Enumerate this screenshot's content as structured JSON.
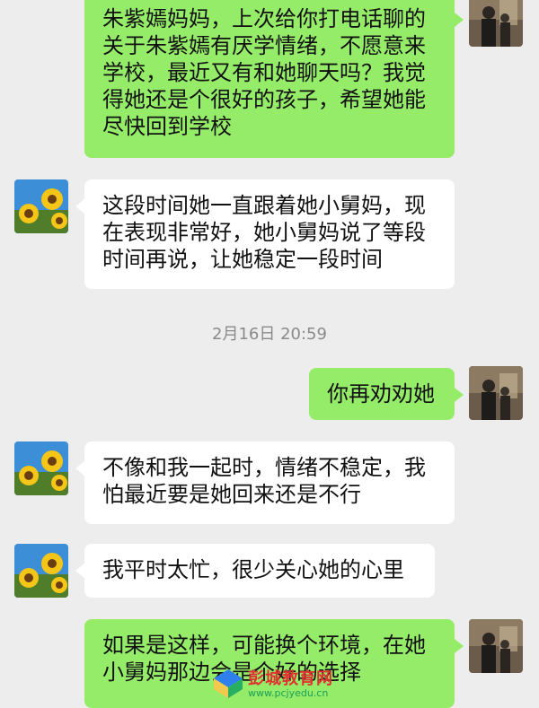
{
  "messages": [
    {
      "side": "right",
      "text": "朱紫嫣妈妈，上次给你打电话聊的关于朱紫嫣有厌学情绪，不愿意来学校，最近又有和她聊天吗？我觉得她还是个很好的孩子，希望她能尽快回到学校"
    },
    {
      "side": "left",
      "text": "这段时间她一直跟着她小舅妈，现在表现非常好，她小舅妈说了等段时间再说，让她稳定一段时间"
    },
    {
      "side": "right",
      "text": "你再劝劝她"
    },
    {
      "side": "left",
      "text": "不像和我一起时，情绪不稳定，我怕最近要是她回来还是不行"
    },
    {
      "side": "left",
      "text": "我平时太忙，很少关心她的心里"
    },
    {
      "side": "right",
      "text": "如果是这样，可能换个环境，在她小舅妈那边会是个好的选择"
    }
  ],
  "timestamp": "2月16日 20:59",
  "watermark": {
    "title": "彭城教育网",
    "url": "www.pcjyedu.cn"
  },
  "colors": {
    "my_bubble": "#95ec69",
    "other_bubble": "#ffffff",
    "background": "#ededed"
  }
}
